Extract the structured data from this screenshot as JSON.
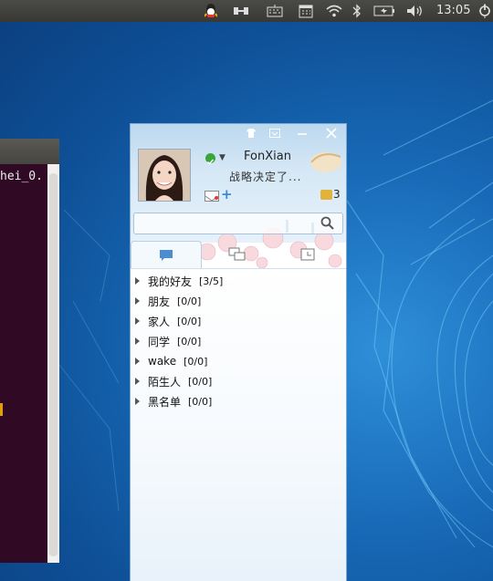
{
  "topbar": {
    "clock": "13:05",
    "tray_icons": [
      "qq-icon",
      "network-tool-icon",
      "keyboard-icon",
      "calendar-icon",
      "wifi-icon",
      "bluetooth-icon",
      "battery-icon",
      "volume-icon",
      "power-icon"
    ]
  },
  "terminal": {
    "visible_text": "hei_0."
  },
  "qq": {
    "nickname": "FonXian",
    "signature": "战略决定了...",
    "message_count": "3",
    "search": {
      "value": "",
      "placeholder": ""
    },
    "groups": [
      {
        "name": "我的好友",
        "count": "[3/5]"
      },
      {
        "name": "朋友",
        "count": "[0/0]"
      },
      {
        "name": "家人",
        "count": "[0/0]"
      },
      {
        "name": "同学",
        "count": "[0/0]"
      },
      {
        "name": "wake",
        "count": "[0/0]"
      },
      {
        "name": "陌生人",
        "count": "[0/0]"
      },
      {
        "name": "黑名单",
        "count": "[0/0]"
      }
    ]
  },
  "colors": {
    "desktop": "#1768b5",
    "panel": "#3c3b37",
    "terminal_bg": "#300a24",
    "online_status": "#3aa53a"
  }
}
